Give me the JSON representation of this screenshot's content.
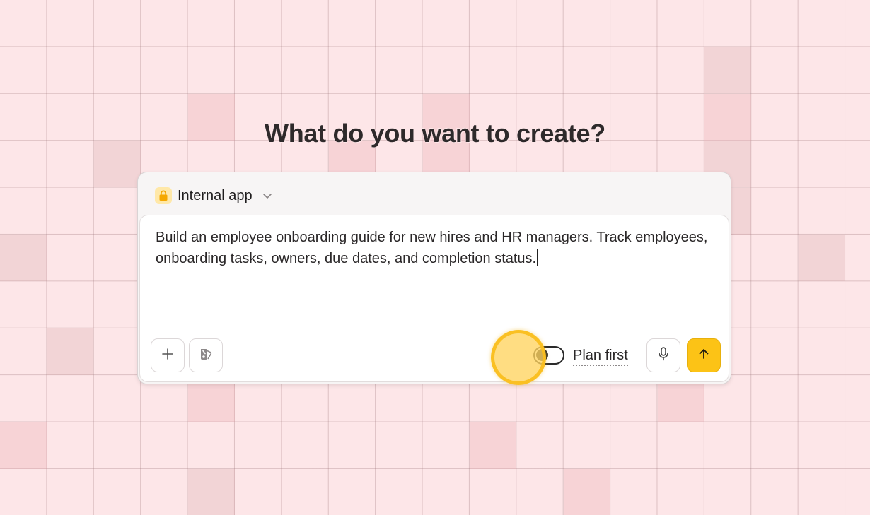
{
  "page": {
    "title": "What do you want to create?"
  },
  "composer": {
    "app_type": {
      "label": "Internal app",
      "icon": "lock-icon",
      "badge_color": "#ffe8a8"
    },
    "prompt": {
      "value": "Build an employee onboarding guide for new hires and HR managers. Track employees, onboarding tasks, owners, due dates, and completion status."
    },
    "toolbar": {
      "add_icon": "plus-icon",
      "style_icon": "palette-icon",
      "plan_toggle": {
        "label": "Plan first",
        "enabled": false
      },
      "mic_icon": "microphone-icon",
      "send_icon": "arrow-up-icon",
      "send_color": "#fcc316"
    }
  },
  "colors": {
    "background": "#fde6e8",
    "accent": "#fcc316",
    "click_indicator": "#fbd35f"
  }
}
